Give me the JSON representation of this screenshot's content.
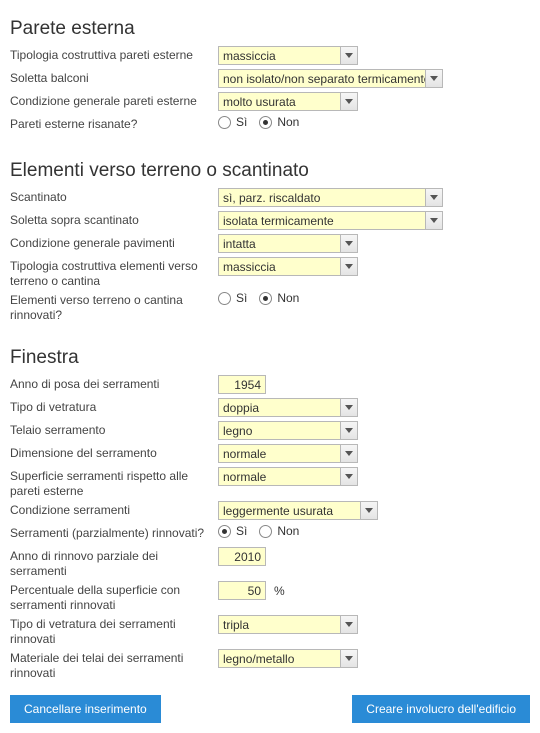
{
  "sections": {
    "parete": {
      "title": "Parete esterna"
    },
    "elementi": {
      "title": "Elementi verso terreno o scantinato"
    },
    "finestra": {
      "title": "Finestra"
    }
  },
  "radio": {
    "si": "Sì",
    "non": "Non"
  },
  "parete": {
    "tipologia_label": "Tipologia costruttiva pareti esterne",
    "tipologia_value": "massiccia",
    "soletta_label": "Soletta balconi",
    "soletta_value": "non isolato/non separato termicamente",
    "condizione_label": "Condizione generale pareti esterne",
    "condizione_value": "molto usurata",
    "risanate_label": "Pareti esterne risanate?",
    "risanate_selected": "non"
  },
  "elementi": {
    "scantinato_label": "Scantinato",
    "scantinato_value": "sì, parz. riscaldato",
    "soletta_label": "Soletta sopra scantinato",
    "soletta_value": "isolata termicamente",
    "condizione_label": "Condizione generale pavimenti",
    "condizione_value": "intatta",
    "tipologia_label": "Tipologia costruttiva elementi verso terreno o cantina",
    "tipologia_value": "massiccia",
    "rinnovati_label": "Elementi verso terreno o cantina rinnovati?",
    "rinnovati_selected": "non"
  },
  "finestra": {
    "anno_label": "Anno di posa dei serramenti",
    "anno_value": "1954",
    "vetratura_label": "Tipo di vetratura",
    "vetratura_value": "doppia",
    "telaio_label": "Telaio serramento",
    "telaio_value": "legno",
    "dimensione_label": "Dimensione del serramento",
    "dimensione_value": "normale",
    "superficie_label": "Superficie serramenti rispetto alle pareti esterne",
    "superficie_value": "normale",
    "condizione_label": "Condizione serramenti",
    "condizione_value": "leggermente usurata",
    "rinnovati_label": "Serramenti (parzialmente) rinnovati?",
    "rinnovati_selected": "si",
    "anno_rinnovo_label": "Anno di rinnovo parziale dei serramenti",
    "anno_rinnovo_value": "2010",
    "percentuale_label": "Percentuale della superficie con serramenti rinnovati",
    "percentuale_value": "50",
    "percentuale_unit": "%",
    "vetratura_rinn_label": "Tipo di vetratura dei serramenti rinnovati",
    "vetratura_rinn_value": "tripla",
    "materiale_rinn_label": "Materiale dei telai dei serramenti rinnovati",
    "materiale_rinn_value": "legno/metallo"
  },
  "footer": {
    "cancel": "Cancellare inserimento",
    "create": "Creare involucro dell'edificio"
  }
}
